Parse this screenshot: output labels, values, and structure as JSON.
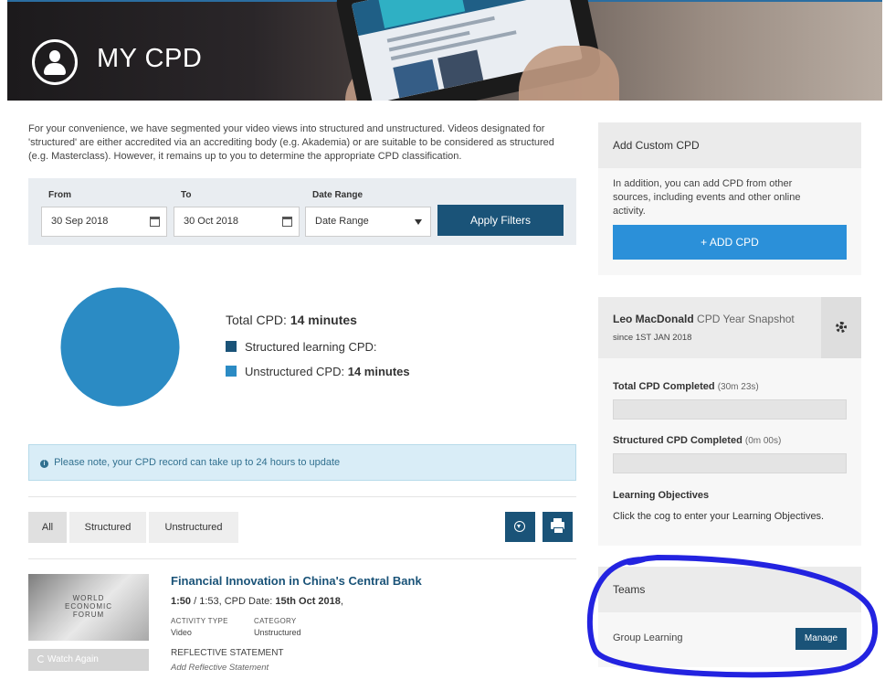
{
  "header": {
    "title": "MY CPD"
  },
  "intro": "For your convenience, we have segmented your video views into structured and unstructured. Videos designated for 'structured' are either accredited via an accrediting body (e.g. Akademia) or are suitable to be considered as structured (e.g. Masterclass). However, it remains up to you to determine the appropriate CPD classification.",
  "filters": {
    "from_label": "From",
    "from_value": "30 Sep 2018",
    "to_label": "To",
    "to_value": "30 Oct 2018",
    "range_label": "Date Range",
    "range_value": "Date Range",
    "apply_label": "Apply Filters"
  },
  "summary": {
    "total_label": "Total CPD:",
    "total_value": "14 minutes",
    "structured_label": "Structured learning CPD:",
    "structured_value": "",
    "unstructured_label": "Unstructured CPD:",
    "unstructured_value": "14 minutes",
    "colors": {
      "structured": "#1a5378",
      "unstructured": "#2b8bc4"
    }
  },
  "notice": "Please note, your CPD record can take up to 24 hours to update",
  "tabs": [
    "All",
    "Structured",
    "Unstructured"
  ],
  "activity": {
    "title": "Financial Innovation in China's Central Bank",
    "progress": "1:50",
    "duration": " / 1:53, CPD Date: ",
    "date": "15th Oct 2018",
    "date_suffix": ",",
    "activity_type_label": "ACTIVITY TYPE",
    "activity_type": "Video",
    "category_label": "CATEGORY",
    "category": "Unstructured",
    "reflective_label": "REFLECTIVE STATEMENT",
    "reflective_value": "Add Reflective Statement",
    "watch_again": "Watch Again",
    "thumb_lines": [
      "WORLD",
      "ECONOMIC",
      "FORUM"
    ]
  },
  "custom_cpd": {
    "title": "Add Custom CPD",
    "text": "In addition, you can add CPD from other sources, including events and other online activity.",
    "button": "+ ADD CPD"
  },
  "snapshot": {
    "name": "Leo MacDonald",
    "title": " CPD Year Snapshot",
    "since": "since 1ST JAN 2018",
    "total_label": "Total CPD Completed",
    "total_value": "(30m 23s)",
    "total_progress": 0,
    "structured_label": "Structured CPD Completed",
    "structured_value": "(0m 00s)",
    "structured_progress": 0,
    "objectives_title": "Learning Objectives",
    "objectives_text": "Click the cog to enter your Learning Objectives."
  },
  "teams": {
    "title": "Teams",
    "group": "Group Learning",
    "manage": "Manage"
  }
}
